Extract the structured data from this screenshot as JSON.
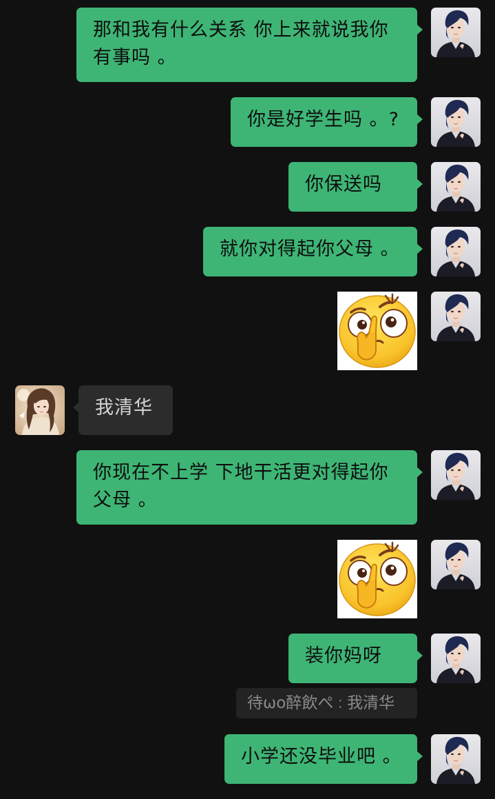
{
  "colors": {
    "background": "#111111",
    "my_bubble": "#3eb575",
    "other_bubble": "#2c2c2c",
    "quote_bg": "#232323"
  },
  "messages": [
    {
      "from": "me",
      "type": "text",
      "text": "那和我有什么关系 你上来就说我你有事吗 。"
    },
    {
      "from": "me",
      "type": "text",
      "text": "你是好学生吗 。?"
    },
    {
      "from": "me",
      "type": "text",
      "text": "你保送吗 。"
    },
    {
      "from": "me",
      "type": "text",
      "text": "就你对得起你父母 。"
    },
    {
      "from": "me",
      "type": "sticker",
      "sticker": "thinking-emoji-sticker"
    },
    {
      "from": "other",
      "type": "text",
      "text": "我清华"
    },
    {
      "from": "me",
      "type": "text",
      "text": "你现在不上学 下地干活更对得起你父母 。"
    },
    {
      "from": "me",
      "type": "sticker",
      "sticker": "thinking-emoji-sticker"
    },
    {
      "from": "me",
      "type": "text",
      "text": "装你妈呀 。"
    },
    {
      "from": "me",
      "type": "text",
      "text": "小学还没毕业吧 。"
    }
  ],
  "quote": {
    "author": "待ωo醉飲ぺ",
    "separator": ":",
    "text": "我清华"
  }
}
